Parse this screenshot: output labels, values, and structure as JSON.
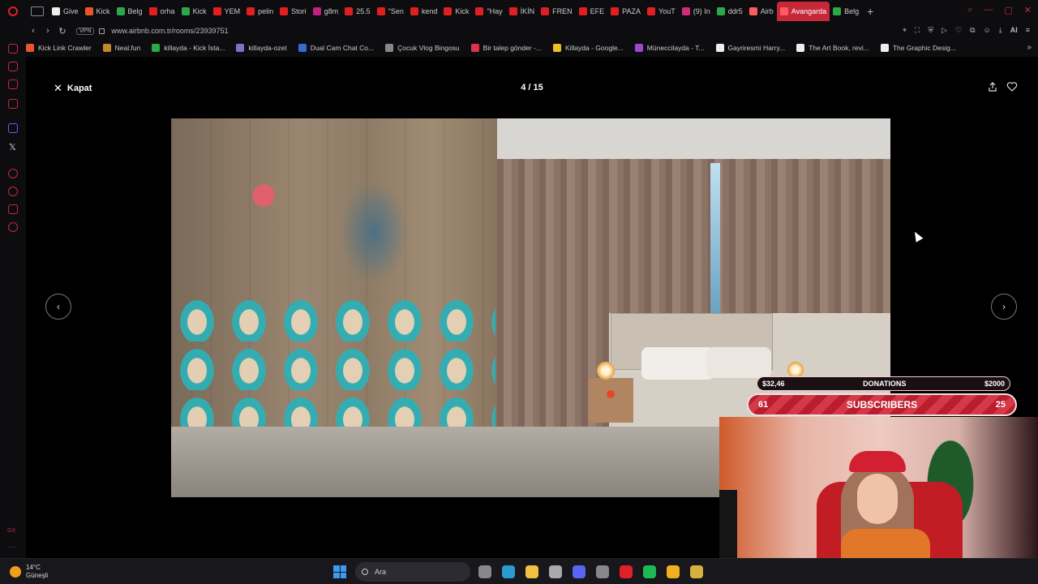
{
  "browser": {
    "tabs": [
      {
        "label": "Give",
        "color": "#eeeeee"
      },
      {
        "label": "Kick",
        "color": "#e8552a"
      },
      {
        "label": "Belg",
        "color": "#2aa84a"
      },
      {
        "label": "orha",
        "color": "#e02020"
      },
      {
        "label": "Kick",
        "color": "#2aa84a"
      },
      {
        "label": "YEM",
        "color": "#e02020"
      },
      {
        "label": "pelin",
        "color": "#e02020"
      },
      {
        "label": "Stori",
        "color": "#e02020"
      },
      {
        "label": "g8m",
        "color": "#c02080"
      },
      {
        "label": "25.5",
        "color": "#e02020"
      },
      {
        "label": "\"Sen",
        "color": "#e02020"
      },
      {
        "label": "kend",
        "color": "#e02020"
      },
      {
        "label": "Kick",
        "color": "#e02020"
      },
      {
        "label": "\"Hay",
        "color": "#e02020"
      },
      {
        "label": "İKİN",
        "color": "#e02020"
      },
      {
        "label": "FREN",
        "color": "#e02020"
      },
      {
        "label": "EFE",
        "color": "#e02020"
      },
      {
        "label": "PAZA",
        "color": "#e02020"
      },
      {
        "label": "YouT",
        "color": "#e02020"
      },
      {
        "label": "(9) In",
        "color": "#d02a7a"
      },
      {
        "label": "ddr5",
        "color": "#2aa84a"
      },
      {
        "label": "Airb",
        "color": "#ff5a5f"
      },
      {
        "label": "Avangarda",
        "color": "#ff5a5f",
        "active": true
      },
      {
        "label": "Belg",
        "color": "#2aa84a"
      }
    ],
    "vpn_label": "VPN",
    "url": "www.airbnb.com.tr/rooms/23939751",
    "address_right_label": "AI",
    "bookmarks": [
      {
        "label": "Kick Link Crawler",
        "color": "#e8552a"
      },
      {
        "label": "Neal.fun",
        "color": "#c28a2a"
      },
      {
        "label": "killayda - Kick İsta...",
        "color": "#2aa84a"
      },
      {
        "label": "killayda-ozet",
        "color": "#8a6ad0"
      },
      {
        "label": "Dual Cam Chat Co...",
        "color": "#3a6ad0"
      },
      {
        "label": "Çocuk Vlog Bingosu",
        "color": "#888888"
      },
      {
        "label": "Bir talep gönder -...",
        "color": "#e03050"
      },
      {
        "label": "Killayda - Google...",
        "color": "#f0c020"
      },
      {
        "label": "Müneccilayda - T...",
        "color": "#9a4ad0"
      },
      {
        "label": "Gayriresmi Harry...",
        "color": "#eeeeee"
      },
      {
        "label": "The Art Book, revi...",
        "color": "#eeeeee"
      },
      {
        "label": "The Graphic Desig...",
        "color": "#eeeeee"
      }
    ]
  },
  "viewer": {
    "close_label": "Kapat",
    "counter": "4 / 15"
  },
  "overlay": {
    "donations_current": "$32,46",
    "donations_label": "DONATIONS",
    "donations_goal": "$2000",
    "subscribers_current": "61",
    "subscribers_label": "SUBSCRIBERS",
    "subscribers_goal": "25"
  },
  "taskbar": {
    "weather_temp": "14°C",
    "weather_desc": "Güneşli",
    "search_placeholder": "Ara",
    "icons": [
      {
        "name": "task-view-icon",
        "color": "#888888"
      },
      {
        "name": "edge-icon",
        "color": "#2a9ad0"
      },
      {
        "name": "file-explorer-icon",
        "color": "#f0c040"
      },
      {
        "name": "settings-icon",
        "color": "#aaaaaa"
      },
      {
        "name": "discord-icon",
        "color": "#5865f2"
      },
      {
        "name": "steam-icon",
        "color": "#888888"
      },
      {
        "name": "opera-gx-icon",
        "color": "#e0202a"
      },
      {
        "name": "spotify-icon",
        "color": "#1db954"
      },
      {
        "name": "chrome-icon",
        "color": "#f0b020"
      },
      {
        "name": "app-icon",
        "color": "#d8b040"
      }
    ]
  }
}
